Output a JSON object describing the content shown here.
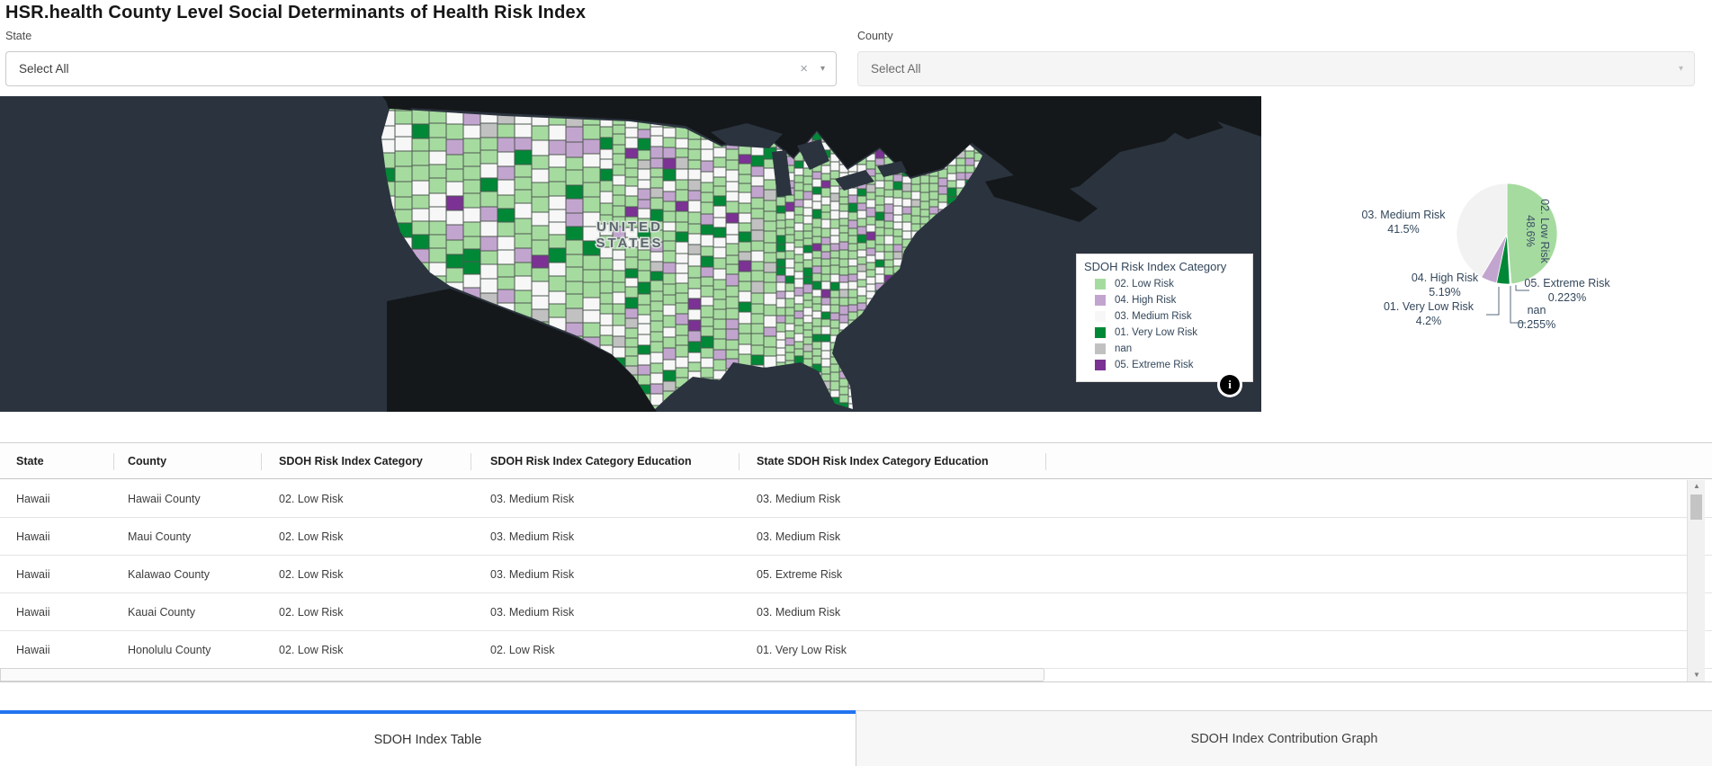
{
  "title": "HSR.health County Level Social Determinants of Health Risk Index",
  "filters": {
    "state": {
      "label": "State",
      "value": "Select All",
      "clear_icon": "×",
      "caret_icon": "▾"
    },
    "county": {
      "label": "County",
      "value": "Select All",
      "caret_icon": "▾"
    }
  },
  "map": {
    "country_label_line1": "UNITED",
    "country_label_line2": "STATES",
    "info_icon_glyph": "i",
    "background_color": "#2b333e",
    "land_color": "#15181b",
    "legend": {
      "title": "SDOH Risk Index Category",
      "items": [
        {
          "label": "02. Low Risk",
          "color": "#a6dba0"
        },
        {
          "label": "04. High Risk",
          "color": "#c2a5cf"
        },
        {
          "label": "03. Medium Risk",
          "color": "#f7f7f7"
        },
        {
          "label": "01. Very Low Risk",
          "color": "#008837"
        },
        {
          "label": "nan",
          "color": "#c1c1c1"
        },
        {
          "label": "05. Extreme Risk",
          "color": "#7b3294"
        }
      ]
    }
  },
  "chart_data": {
    "type": "pie",
    "legend_position": "none",
    "direction": "clockwise",
    "start_angle_deg": 0,
    "value_format": "percent",
    "slices": [
      {
        "label": "02. Low Risk",
        "value": 48.6,
        "pct_label": "48.6%",
        "color": "#a6dba0",
        "label_placement": "inside-rotated"
      },
      {
        "label": "05. Extreme Risk",
        "value": 0.223,
        "pct_label": "0.223%",
        "color": "#7b3294",
        "label_placement": "outside"
      },
      {
        "label": "nan",
        "value": 0.255,
        "pct_label": "0.255%",
        "color": "#c1c1c1",
        "label_placement": "outside"
      },
      {
        "label": "01. Very Low Risk",
        "value": 4.2,
        "pct_label": "4.2%",
        "color": "#008837",
        "label_placement": "outside"
      },
      {
        "label": "04. High Risk",
        "value": 5.19,
        "pct_label": "5.19%",
        "color": "#c2a5cf",
        "label_placement": "outside"
      },
      {
        "label": "03. Medium Risk",
        "value": 41.5,
        "pct_label": "41.5%",
        "color": "#f2f2f2",
        "label_placement": "outside"
      }
    ]
  },
  "table": {
    "columns": [
      "State",
      "County",
      "SDOH Risk Index Category",
      "SDOH Risk Index Category Education",
      "State SDOH Risk Index Category Education"
    ],
    "rows": [
      [
        "Hawaii",
        "Hawaii County",
        "02. Low Risk",
        "03. Medium Risk",
        "03. Medium Risk"
      ],
      [
        "Hawaii",
        "Maui County",
        "02. Low Risk",
        "03. Medium Risk",
        "03. Medium Risk"
      ],
      [
        "Hawaii",
        "Kalawao County",
        "02. Low Risk",
        "03. Medium Risk",
        "05. Extreme Risk"
      ],
      [
        "Hawaii",
        "Kauai County",
        "02. Low Risk",
        "03. Medium Risk",
        "03. Medium Risk"
      ],
      [
        "Hawaii",
        "Honolulu County",
        "02. Low Risk",
        "02. Low Risk",
        "01. Very Low Risk"
      ]
    ],
    "scroll_up_icon": "▲",
    "scroll_down_icon": "▼"
  },
  "tabs": [
    {
      "label": "SDOH Index Table",
      "active": true
    },
    {
      "label": "SDOH Index Contribution Graph",
      "active": false
    }
  ],
  "colors": {
    "accent_tab_blue": "#2273f0",
    "legend_text": "#32465a",
    "pie_label_text": "#33475b"
  }
}
